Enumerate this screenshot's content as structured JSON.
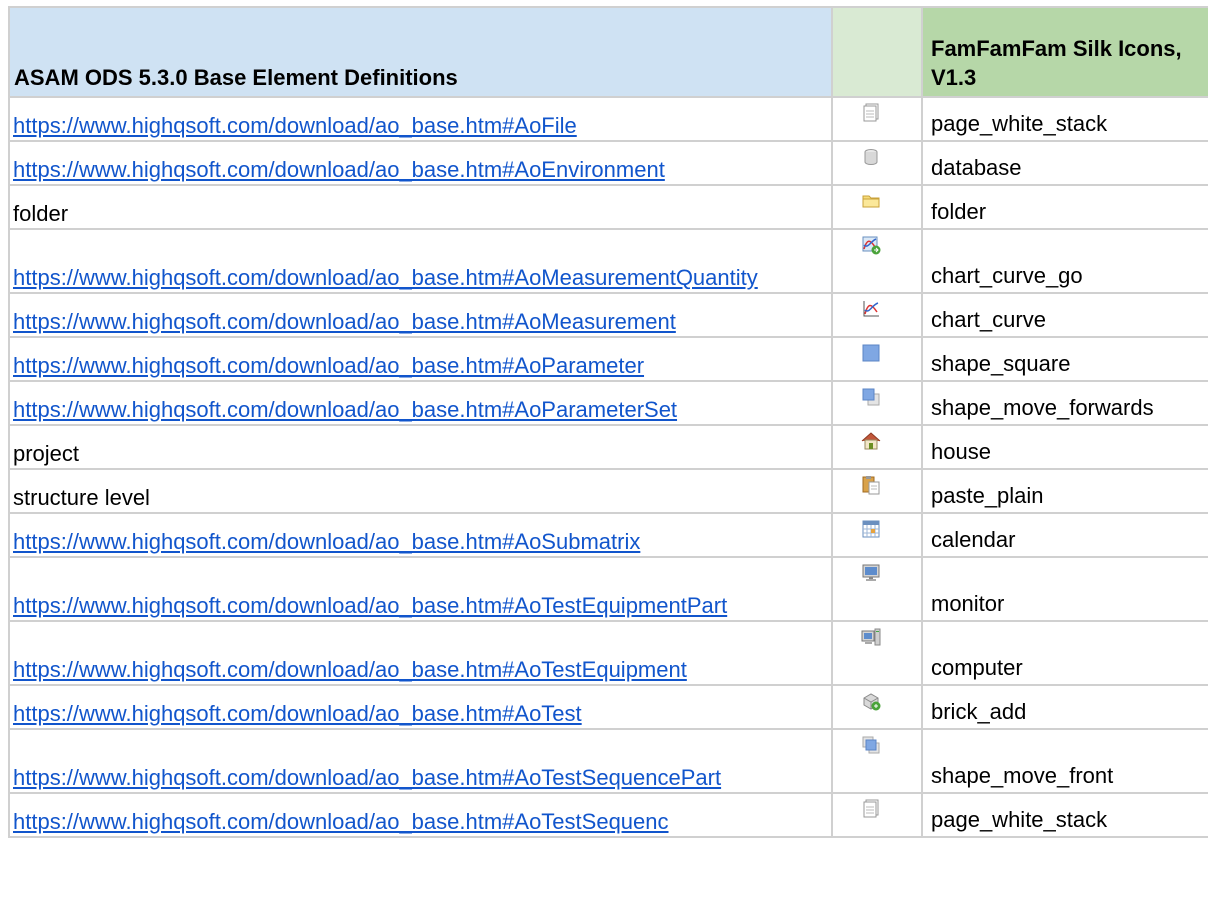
{
  "header": {
    "col1": "ASAM ODS 5.3.0 Base Element Definitions",
    "col3": "FamFamFam Silk Icons, V1.3"
  },
  "rows": [
    {
      "def": "https://www.highqsoft.com/download/ao_base.htm#AoFile",
      "is_link": true,
      "icon": "page-white-stack-icon",
      "name": "page_white_stack"
    },
    {
      "def": "https://www.highqsoft.com/download/ao_base.htm#AoEnvironment",
      "is_link": true,
      "icon": "database-icon",
      "name": "database"
    },
    {
      "def": "folder",
      "is_link": false,
      "icon": "folder-icon",
      "name": "folder"
    },
    {
      "def": "https://www.highqsoft.com/download/ao_base.htm#AoMeasurementQuantity",
      "is_link": true,
      "icon": "chart-curve-go-icon",
      "name": "chart_curve_go"
    },
    {
      "def": "https://www.highqsoft.com/download/ao_base.htm#AoMeasurement",
      "is_link": true,
      "icon": "chart-curve-icon",
      "name": "chart_curve"
    },
    {
      "def": "https://www.highqsoft.com/download/ao_base.htm#AoParameter",
      "is_link": true,
      "icon": "shape-square-icon",
      "name": "shape_square"
    },
    {
      "def": "https://www.highqsoft.com/download/ao_base.htm#AoParameterSet",
      "is_link": true,
      "icon": "shape-move-forwards-icon",
      "name": "shape_move_forwards"
    },
    {
      "def": "project",
      "is_link": false,
      "icon": "house-icon",
      "name": "house"
    },
    {
      "def": "structure level",
      "is_link": false,
      "icon": "paste-plain-icon",
      "name": "paste_plain"
    },
    {
      "def": "https://www.highqsoft.com/download/ao_base.htm#AoSubmatrix",
      "is_link": true,
      "icon": "calendar-icon",
      "name": "calendar"
    },
    {
      "def": "https://www.highqsoft.com/download/ao_base.htm#AoTestEquipmentPart",
      "is_link": true,
      "icon": "monitor-icon",
      "name": "monitor"
    },
    {
      "def": "https://www.highqsoft.com/download/ao_base.htm#AoTestEquipment",
      "is_link": true,
      "icon": "computer-icon",
      "name": "computer"
    },
    {
      "def": "https://www.highqsoft.com/download/ao_base.htm#AoTest",
      "is_link": true,
      "icon": "brick-add-icon",
      "name": "brick_add"
    },
    {
      "def": "https://www.highqsoft.com/download/ao_base.htm#AoTestSequencePart",
      "is_link": true,
      "icon": "shape-move-front-icon",
      "name": "shape_move_front"
    },
    {
      "def": "https://www.highqsoft.com/download/ao_base.htm#AoTestSequenc",
      "is_link": true,
      "icon": "page-white-stack-icon",
      "name": "page_white_stack"
    }
  ]
}
